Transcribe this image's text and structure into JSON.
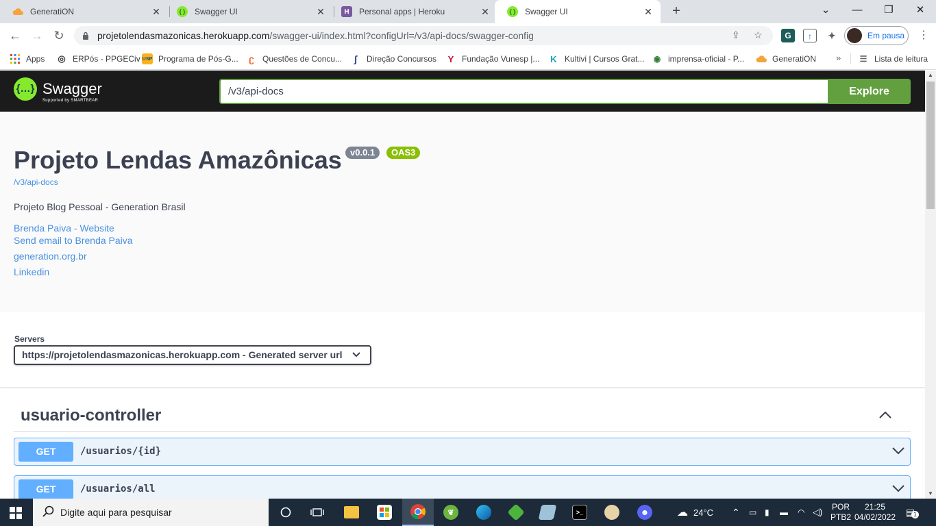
{
  "browser": {
    "tabs": [
      {
        "title": "GeneratiON",
        "color": "#f4a43a"
      },
      {
        "title": "Swagger UI",
        "color": "#85ea2d"
      },
      {
        "title": "Personal apps | Heroku",
        "color": "#79589f"
      },
      {
        "title": "Swagger UI",
        "color": "#85ea2d"
      }
    ],
    "url_host": "projetolendasmazonicas.herokuapp.com",
    "url_path": "/swagger-ui/index.html?configUrl=/v3/api-docs/swagger-config",
    "profile_label": "Em pausa",
    "extension_g": "G"
  },
  "bookmarks": {
    "items": [
      "Apps",
      "ERPós - PPGECiv",
      "Programa de Pós-G...",
      "Questões de Concu...",
      "Direção Concursos",
      "Fundação Vunesp |...",
      "Kultivi | Cursos Grat...",
      "imprensa-oficial - P...",
      "GeneratiON"
    ],
    "more": "»",
    "reading_list": "Lista de leitura",
    "usp_badge": "USP",
    "kultivi_badge": "K"
  },
  "swagger": {
    "logo_text": "Swagger",
    "logo_sub": "Supported by SMARTBEAR",
    "logo_glyph": "{…}",
    "search_value": "/v3/api-docs",
    "explore_label": "Explore",
    "title": "Projeto Lendas Amazônicas",
    "version_badge": "v0.0.1",
    "oas_badge": "OAS3",
    "spec_url": "/v3/api-docs",
    "description": "Projeto Blog Pessoal - Generation Brasil",
    "links": [
      "Brenda Paiva - Website",
      "Send email to Brenda Paiva",
      "generation.org.br",
      "Linkedin"
    ],
    "servers_label": "Servers",
    "server_selected": "https://projetolendasmazonicas.herokuapp.com - Generated server url",
    "tag": "usuario-controller",
    "operations": [
      {
        "method": "GET",
        "path": "/usuarios/{id}"
      },
      {
        "method": "GET",
        "path": "/usuarios/all"
      }
    ],
    "colors": {
      "accent": "#62a03f",
      "get": "#61affe",
      "link": "#4990e2",
      "version": "#7d8492",
      "oas": "#89bf04"
    }
  },
  "taskbar": {
    "search_placeholder": "Digite aqui para pesquisar",
    "weather": "24°C",
    "lang_top": "POR",
    "lang_bottom": "PTB2",
    "time": "21:25",
    "date": "04/02/2022",
    "notifications": "1"
  }
}
